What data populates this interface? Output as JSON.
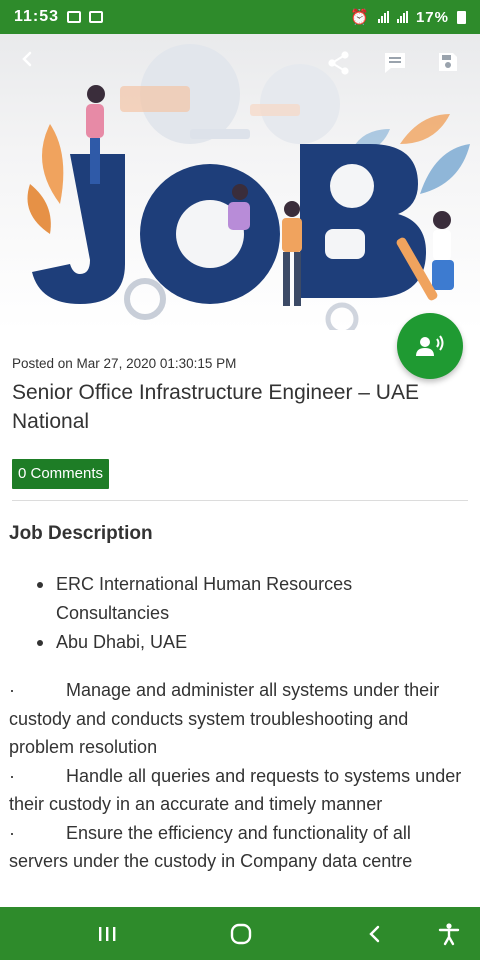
{
  "status_bar": {
    "time": "11:53",
    "battery": "17%"
  },
  "app_bar": {
    "icons": [
      "back-icon",
      "share-icon",
      "comment-icon",
      "save-icon"
    ]
  },
  "hero": {
    "headline": "JOB"
  },
  "post": {
    "posted": "Posted on Mar 27, 2020 01:30:15 PM",
    "title": "Senior Office Infrastructure Engineer – UAE National",
    "comments_label": "0 Comments"
  },
  "job": {
    "section_title": "Job Description",
    "bullets": [
      "ERC International Human Resources Consultancies",
      "Abu Dhabi, UAE"
    ],
    "duties": [
      "Manage and administer all systems under their custody and conducts system troubleshooting and problem resolution",
      "Handle all queries and requests to systems under their custody in an accurate and timely manner",
      "Ensure the efficiency and functionality of all servers under the custody in Company data centre"
    ],
    "duty_marker": "·"
  },
  "colors": {
    "brand_green": "#2e8b2b",
    "badge_green": "#1e7d26",
    "fab_green": "#1f9a32",
    "job_navy": "#1e3e7a"
  }
}
